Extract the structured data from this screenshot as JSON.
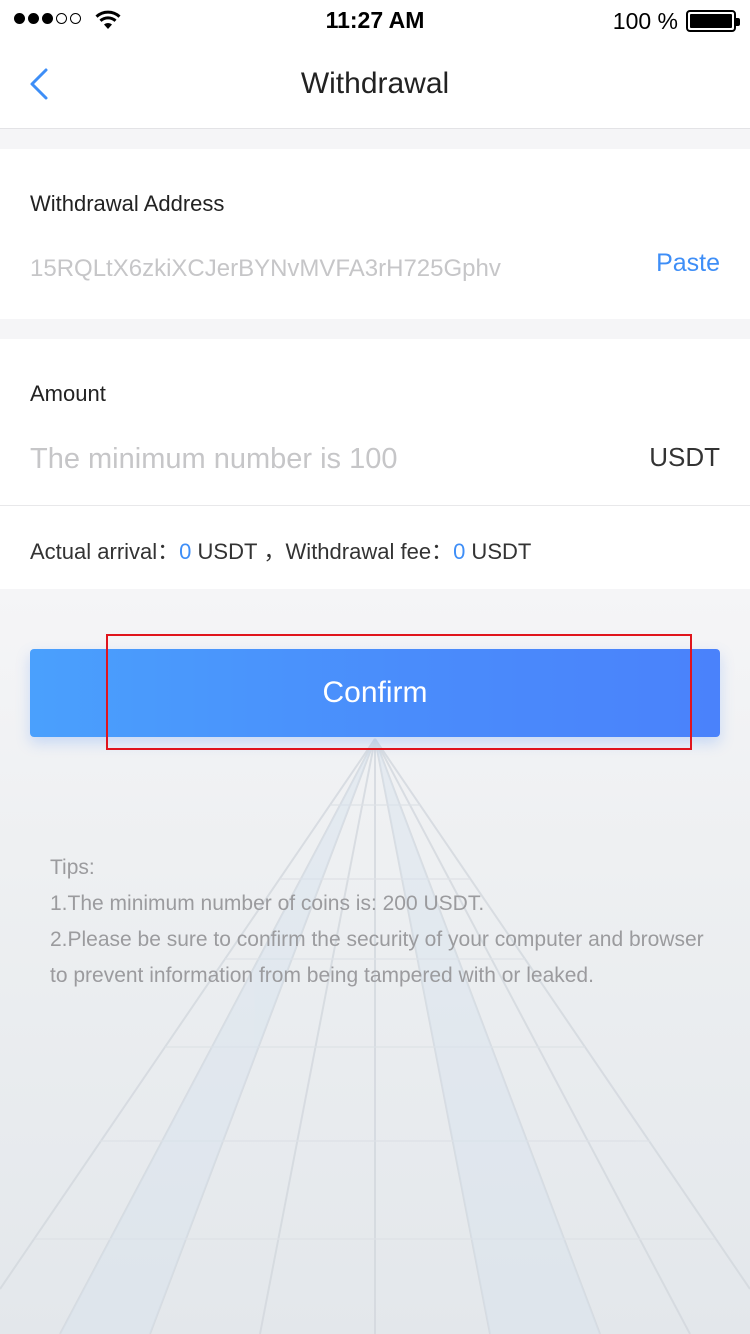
{
  "status_bar": {
    "time": "11:27 AM",
    "battery_percent": "100 %",
    "signal_strength": 3,
    "signal_total": 5
  },
  "nav": {
    "title": "Withdrawal",
    "back_icon": "chevron-left-icon"
  },
  "address": {
    "label": "Withdrawal Address",
    "placeholder": "15RQLtX6zkiXCJerBYNvMVFA3rH725Gphv",
    "paste_label": "Paste"
  },
  "amount": {
    "label": "Amount",
    "placeholder": "The minimum number is 100",
    "unit": "USDT"
  },
  "summary": {
    "arrival_label": "Actual arrival：",
    "arrival_value": "0",
    "arrival_unit": " USDT",
    "separator": "，",
    "fee_label": "Withdrawal fee：",
    "fee_value": "0",
    "fee_unit": " USDT"
  },
  "confirm_label": "Confirm",
  "tips": {
    "heading": "Tips:",
    "line1": "1.The minimum number of coins is: 200 USDT.",
    "line2": "2.Please be sure to confirm the security of your computer and browser to prevent information from being tampered with or leaked."
  },
  "colors": {
    "accent": "#3e8ef7",
    "button_gradient_start": "#4aa0fd",
    "button_gradient_end": "#4a82fb",
    "highlight": "#e0141c"
  }
}
